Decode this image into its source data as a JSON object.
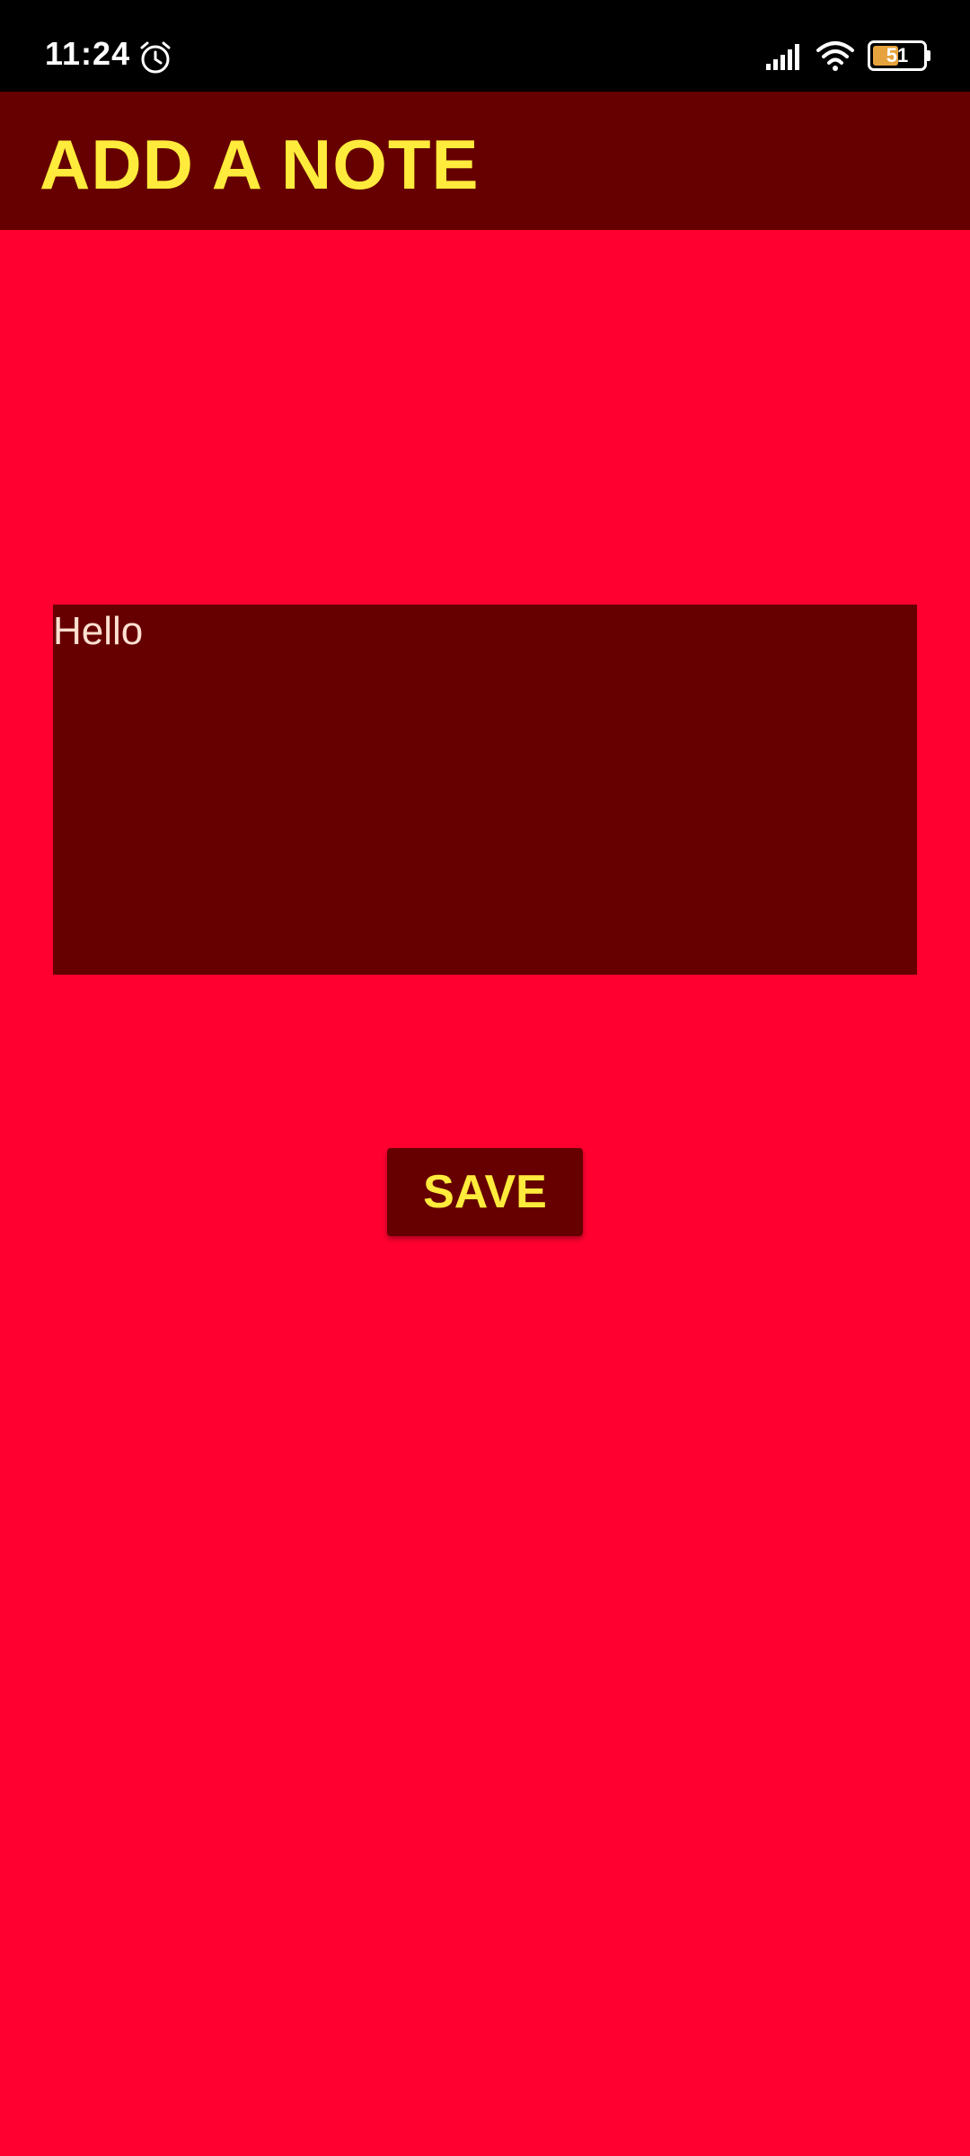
{
  "status_bar": {
    "time": "11:24",
    "battery_level": "51",
    "battery_fraction": 0.51,
    "icons": [
      "alarm-icon",
      "signal-icon",
      "wifi-icon",
      "battery-icon"
    ]
  },
  "app_bar": {
    "title": "ADD A NOTE"
  },
  "note": {
    "value": "Hello"
  },
  "actions": {
    "save_label": "SAVE"
  },
  "colors": {
    "background": "#FF0030",
    "surface": "#660000",
    "accent_text": "#FFEB3B",
    "note_text": "#FFE0D0"
  }
}
